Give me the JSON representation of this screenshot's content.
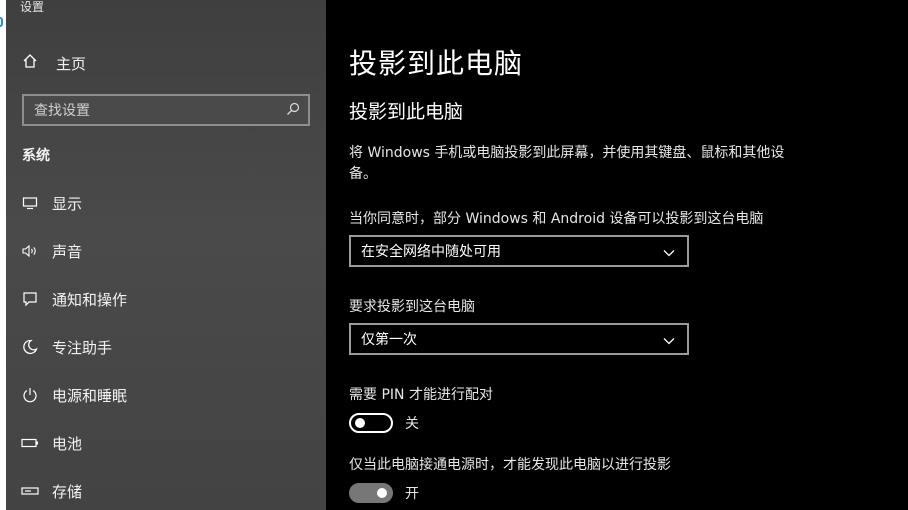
{
  "app": {
    "title": "设置"
  },
  "sidebar": {
    "home_label": "主页",
    "search_placeholder": "查找设置",
    "section": "系统",
    "items": [
      {
        "label": "显示",
        "icon": "display-icon"
      },
      {
        "label": "声音",
        "icon": "speaker-icon"
      },
      {
        "label": "通知和操作",
        "icon": "notification-icon"
      },
      {
        "label": "专注助手",
        "icon": "moon-icon"
      },
      {
        "label": "电源和睡眠",
        "icon": "power-icon"
      },
      {
        "label": "电池",
        "icon": "battery-icon"
      },
      {
        "label": "存储",
        "icon": "storage-icon"
      }
    ]
  },
  "main": {
    "title": "投影到此电脑",
    "subtitle": "投影到此电脑",
    "description": "将 Windows 手机或电脑投影到此屏幕，并使用其键盘、鼠标和其他设备。",
    "availability_label": "当你同意时，部分 Windows 和 Android 设备可以投影到这台电脑",
    "availability_value": "在安全网络中随处可用",
    "request_label": "要求投影到这台电脑",
    "request_value": "仅第一次",
    "pin_label": "需要 PIN 才能进行配对",
    "pin_state": "关",
    "power_label": "仅当此电脑接通电源时，才能发现此电脑以进行投影",
    "power_state": "开"
  },
  "colors": {
    "sidebar_bg": "#474747",
    "main_bg": "#000000",
    "text": "#ffffff"
  }
}
